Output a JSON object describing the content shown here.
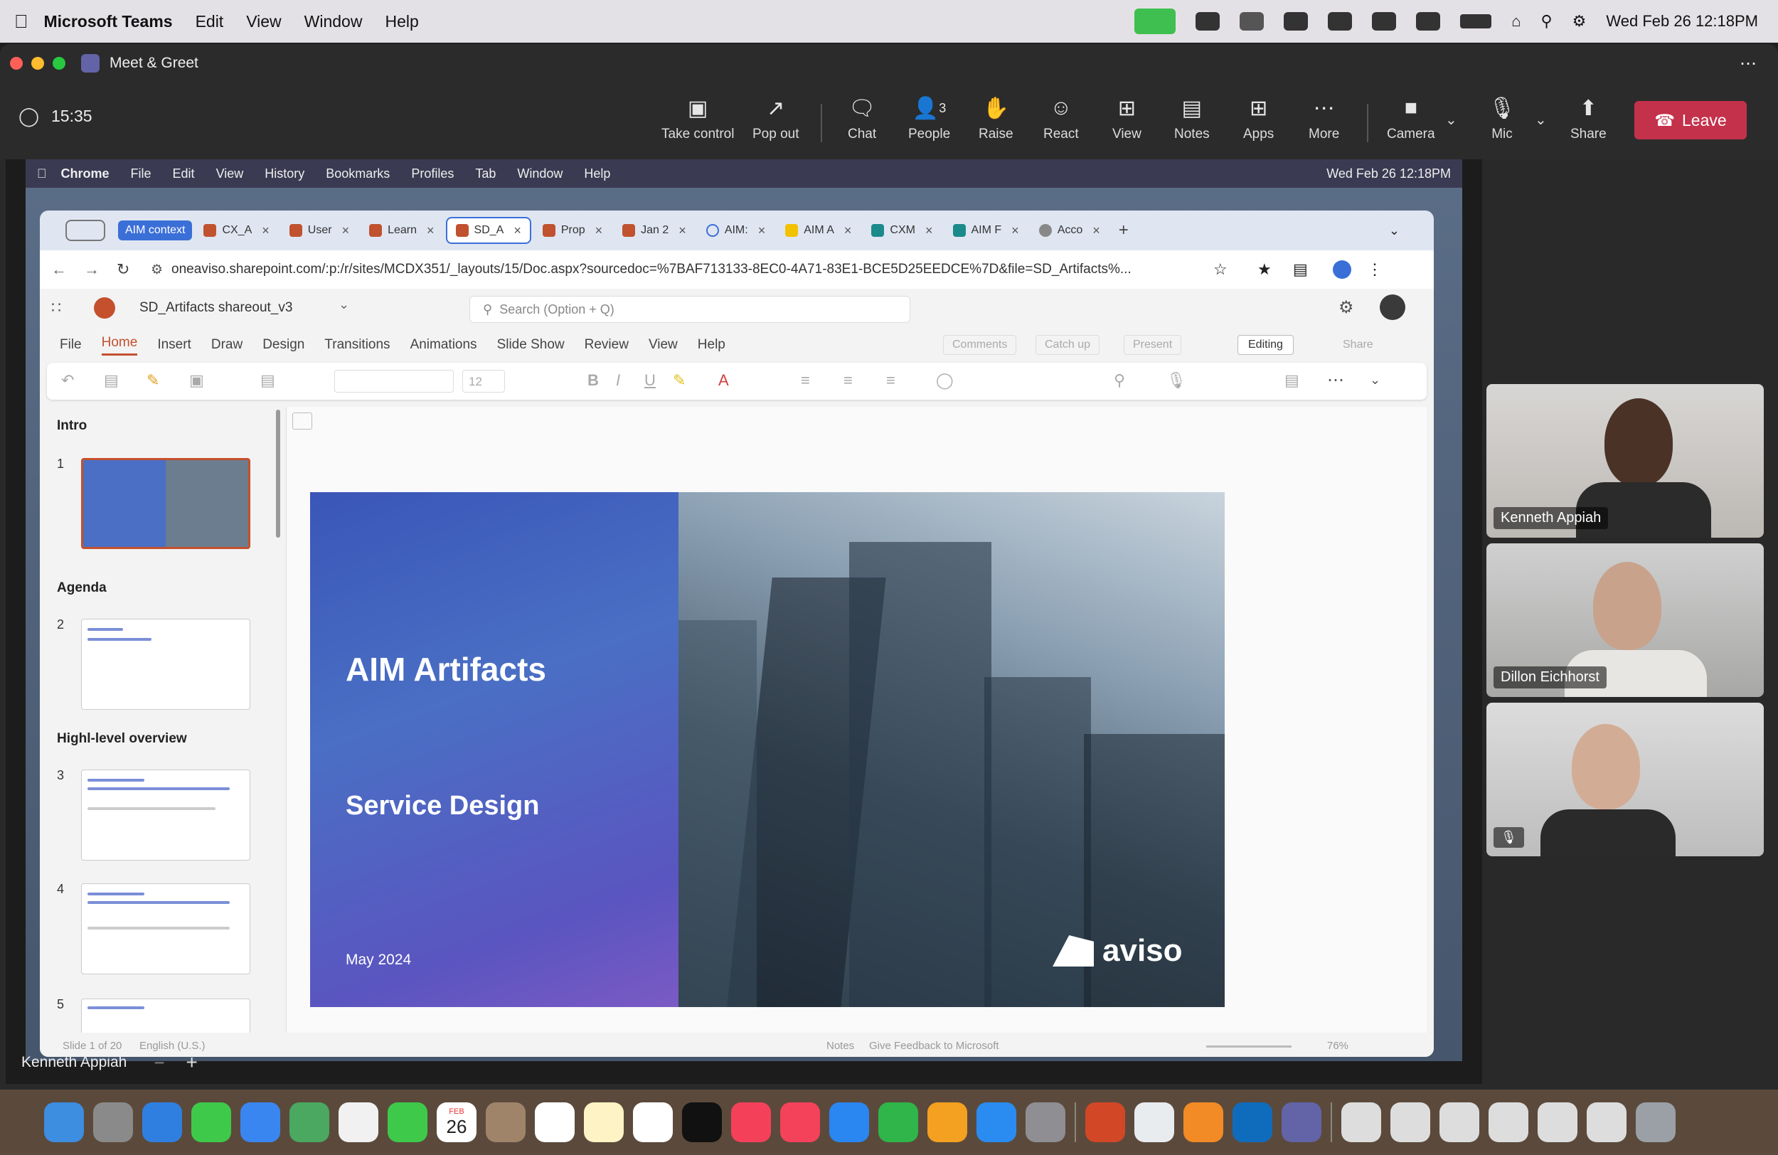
{
  "mac_menubar": {
    "app_name": "Microsoft Teams",
    "items": [
      "Edit",
      "View",
      "Window",
      "Help"
    ],
    "clock": "Wed Feb 26  12:18PM"
  },
  "teams": {
    "window_title": "Meet & Greet",
    "timer": "15:35",
    "toolbar": [
      {
        "label": "Take control",
        "icon": "take-control-icon"
      },
      {
        "label": "Pop out",
        "icon": "pop-out-icon"
      },
      {
        "label": "Chat",
        "icon": "chat-icon"
      },
      {
        "label": "People",
        "icon": "people-icon",
        "count": "3"
      },
      {
        "label": "Raise",
        "icon": "raise-hand-icon"
      },
      {
        "label": "React",
        "icon": "react-icon"
      },
      {
        "label": "View",
        "icon": "view-icon"
      },
      {
        "label": "Notes",
        "icon": "notes-icon"
      },
      {
        "label": "Apps",
        "icon": "apps-icon"
      },
      {
        "label": "More",
        "icon": "more-icon"
      },
      {
        "label": "Camera",
        "icon": "camera-icon"
      },
      {
        "label": "Mic",
        "icon": "mic-muted-icon"
      },
      {
        "label": "Share",
        "icon": "share-icon"
      }
    ],
    "leave_label": "Leave",
    "self_name": "Kenneth Appiah",
    "participants": [
      {
        "name": "Kenneth Appiah"
      },
      {
        "name": "Dillon Eichhorst"
      },
      {
        "name": ""
      }
    ]
  },
  "shared": {
    "inner_menubar": {
      "app": "Chrome",
      "items": [
        "File",
        "Edit",
        "View",
        "History",
        "Bookmarks",
        "Profiles",
        "Tab",
        "Window",
        "Help"
      ],
      "clock": "Wed Feb 26  12:18PM"
    },
    "chrome": {
      "tab_group_label": "AIM context",
      "tabs": [
        "CX_A",
        "User",
        "Learn",
        "SD_A",
        "Prop",
        "Jan 2",
        "AIM:",
        "AIM A",
        "CXM",
        "AIM F",
        "Acco"
      ],
      "active_tab_index": 3,
      "url": "oneaviso.sharepoint.com/:p:/r/sites/MCDX351/_layouts/15/Doc.aspx?sourcedoc=%7BAF713133-8EC0-4A71-83E1-BCE5D25EEDCE%7D&file=SD_Artifacts%..."
    },
    "ppt": {
      "doc_title": "SD_Artifacts shareout_v3",
      "search_placeholder": "Search (Option + Q)",
      "ribbon_tabs": [
        "File",
        "Home",
        "Insert",
        "Draw",
        "Design",
        "Transitions",
        "Animations",
        "Slide Show",
        "Review",
        "View",
        "Help"
      ],
      "ribbon_right": [
        "Comments",
        "Catch up",
        "Present",
        "Editing",
        "Share"
      ],
      "font_size": "12",
      "sections": [
        {
          "title": "Intro",
          "slides": [
            "1"
          ]
        },
        {
          "title": "Agenda",
          "slides": [
            "2"
          ]
        },
        {
          "title": "Highl-level overview",
          "slides": [
            "3",
            "4",
            "5"
          ]
        }
      ],
      "slide": {
        "title": "AIM Artifacts",
        "subtitle": "Service Design",
        "date": "May 2024",
        "logo": "aviso"
      },
      "status": {
        "slide_count": "Slide 1 of 20",
        "language": "English (U.S.)",
        "notes": "Notes",
        "feedback": "Give Feedback to Microsoft",
        "zoom": "76%"
      }
    }
  },
  "dock": {
    "calendar_month": "FEB",
    "calendar_day": "26"
  }
}
